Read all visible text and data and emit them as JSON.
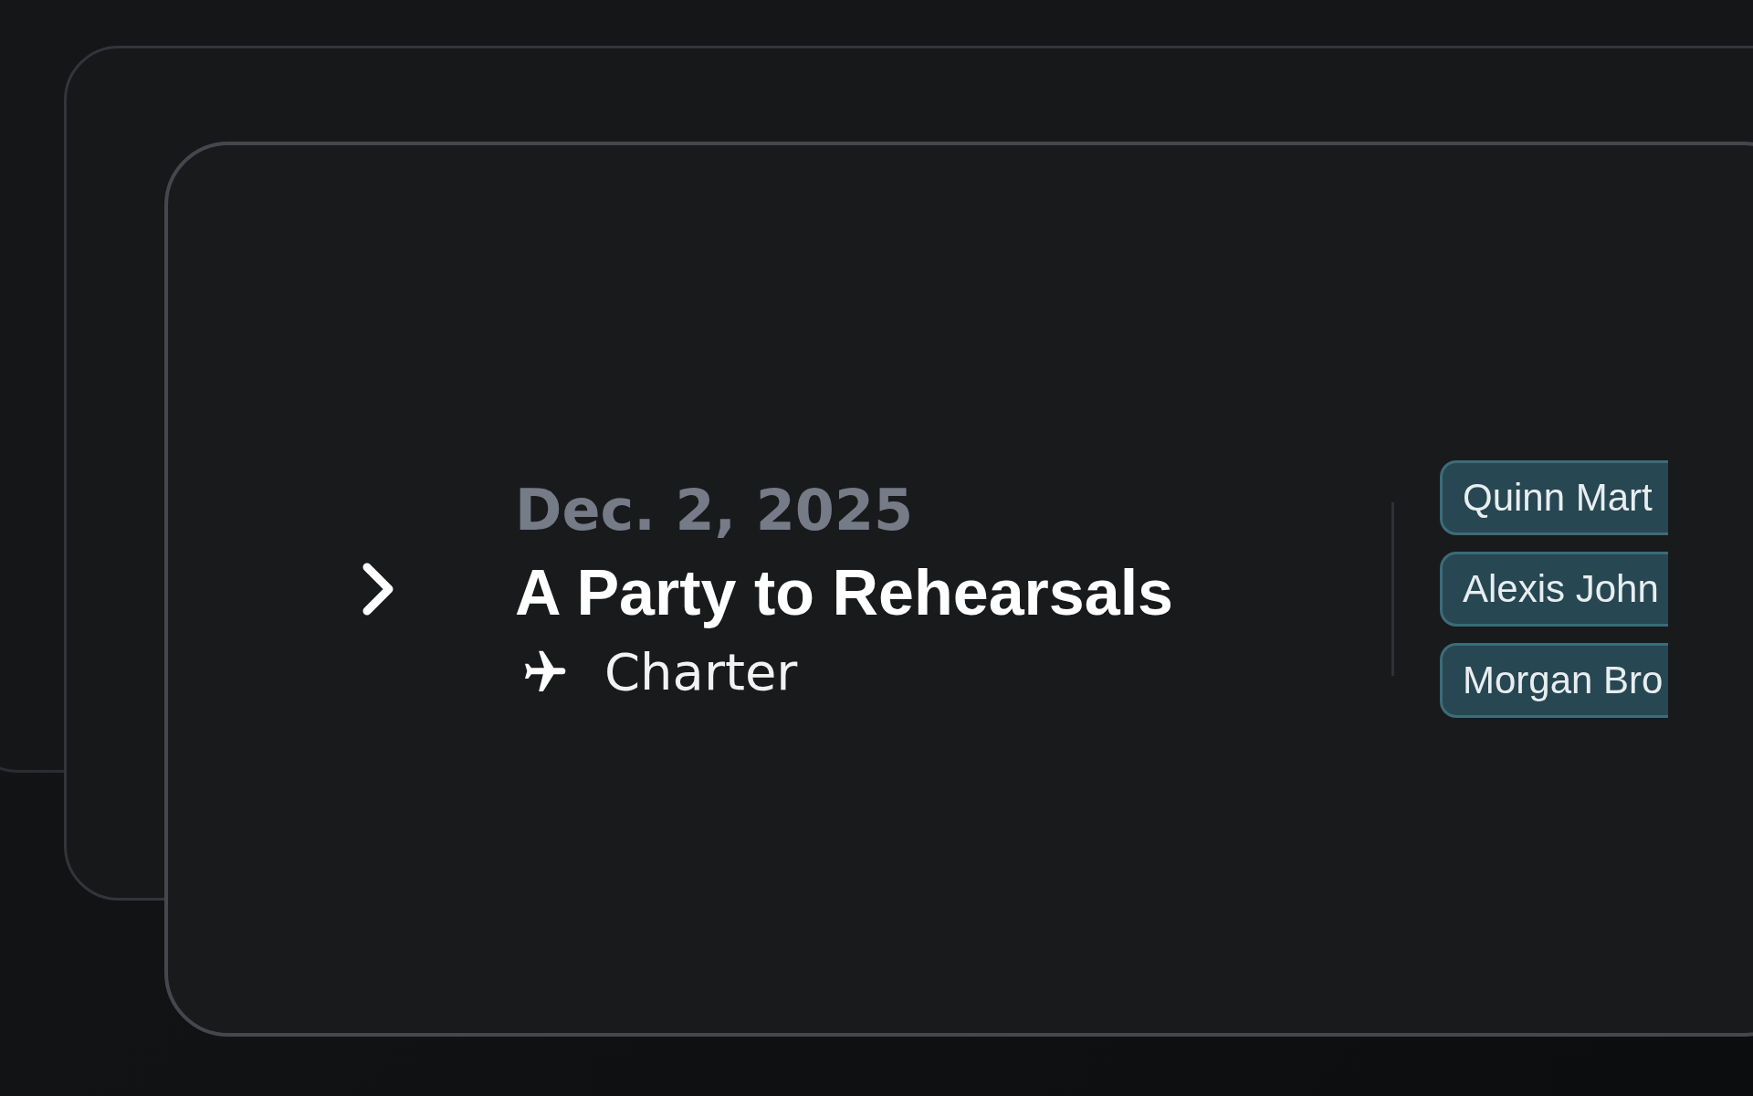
{
  "trip": {
    "expanded": false,
    "date": "Dec. 2, 2025",
    "title": "A Party to Rehearsals",
    "type": "Charter"
  },
  "people": [
    {
      "name": "Quinn Mart"
    },
    {
      "name": "Alexis John"
    },
    {
      "name": "Morgan Bro"
    }
  ]
}
